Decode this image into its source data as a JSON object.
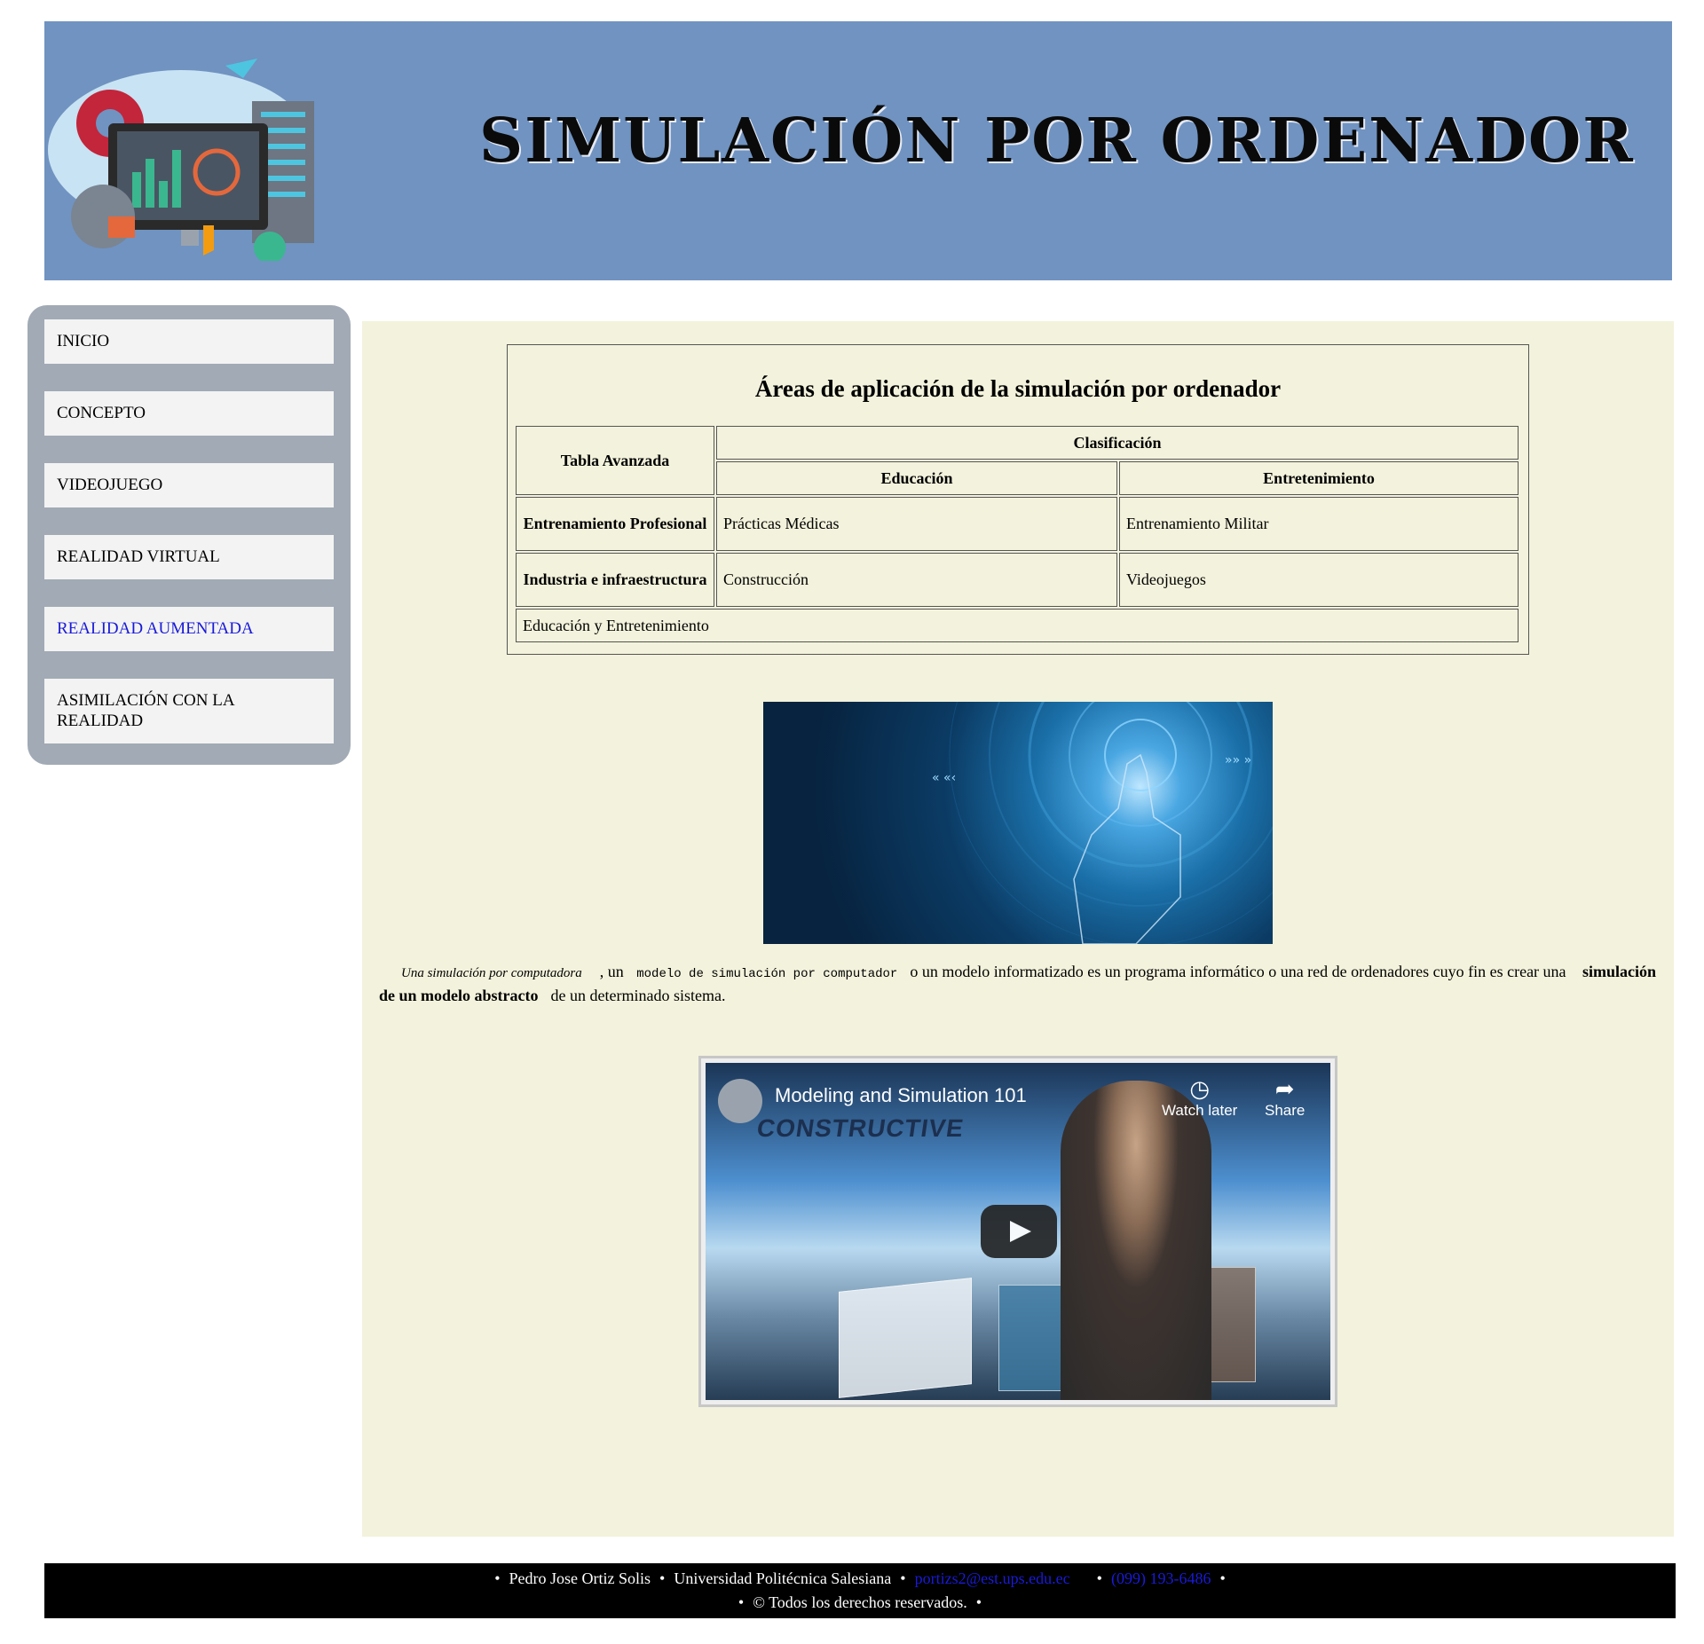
{
  "header": {
    "title": "SIMULACIÓN POR ORDENADOR",
    "logo_icon": "computer-simulation-logo"
  },
  "sidebar": {
    "items": [
      {
        "label": "INICIO"
      },
      {
        "label": "CONCEPTO"
      },
      {
        "label": "VIDEOJUEGO"
      },
      {
        "label": "REALIDAD VIRTUAL"
      },
      {
        "label": "REALIDAD AUMENTADA"
      },
      {
        "label": "ASIMILACIÓN CON LA REALIDAD"
      }
    ]
  },
  "table_section": {
    "title": "Áreas de aplicación de la simulación por ordenador",
    "corner_header": "Tabla Avanzada",
    "group_header": "Clasificación",
    "columns": [
      "Educación",
      "Entretenimiento"
    ],
    "rows": [
      {
        "header": "Entrenamiento Profesional",
        "cells": [
          "Prácticas Médicas",
          "Entrenamiento Militar"
        ]
      },
      {
        "header": "Industria e infraestructura",
        "cells": [
          "Construcción",
          "Videojuegos"
        ]
      }
    ],
    "footer_row": "Educación y Entretenimiento"
  },
  "paragraph": {
    "italic": "Una simulación por computadora",
    "t1": ", un",
    "mono": "modelo de simulación por computador",
    "t2": "o un modelo informatizado es un programa informático o una red de ordenadores cuyo fin es crear una",
    "bold": "simulación de un modelo abstracto",
    "t3": "de un determinado sistema."
  },
  "video": {
    "title": "Modeling and Simulation 101",
    "watermark": "CONSTRUCTIVE",
    "watch_later": "Watch later",
    "share": "Share"
  },
  "footer": {
    "name": "Pedro Jose Ortiz Solis",
    "university": "Universidad Politécnica Salesiana",
    "email": "portizs2@est.ups.edu.ec",
    "phone": "(099) 193-6486",
    "rights": "© Todos los derechos reservados.",
    "bullet": "•"
  },
  "colors": {
    "header_bg": "#7093c1",
    "sidebar_bg": "#a1aab5",
    "main_bg": "#f3f2dc",
    "footer_bg": "#000000",
    "link": "#1a1ad9"
  }
}
